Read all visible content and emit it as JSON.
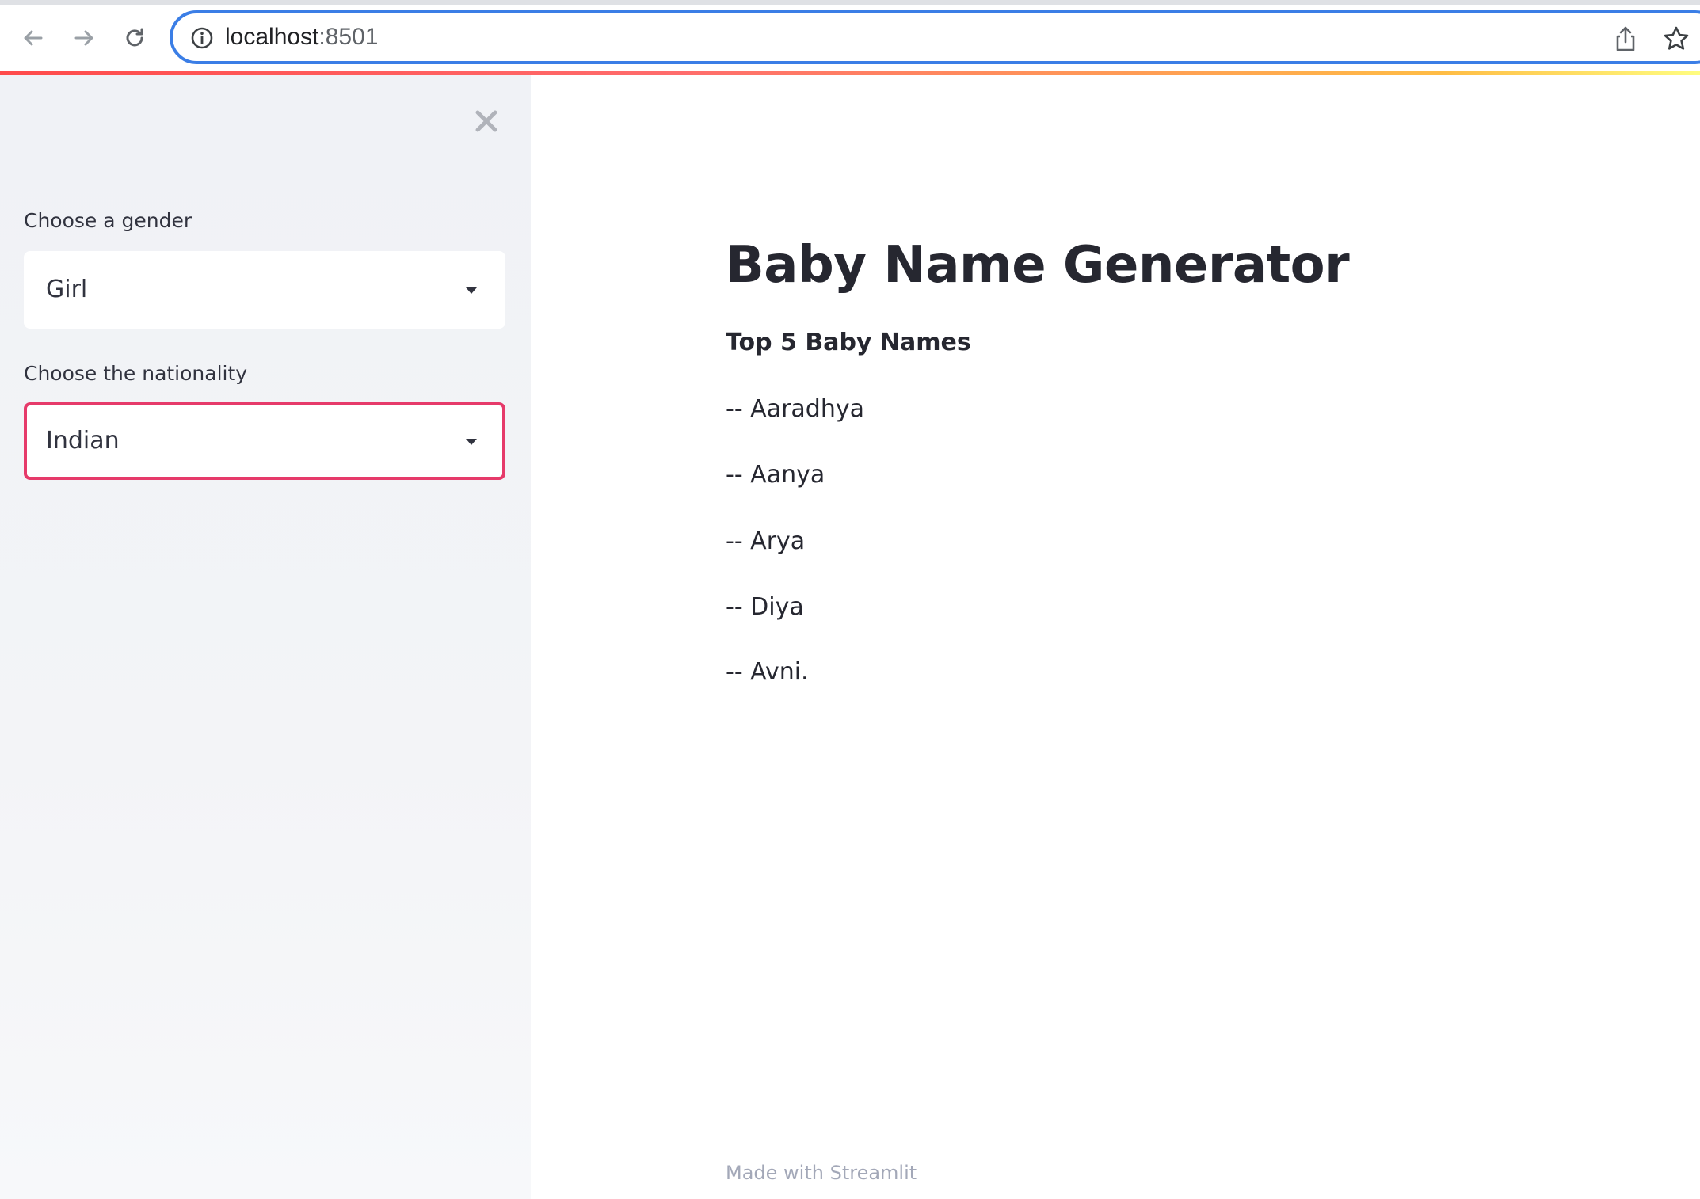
{
  "browser": {
    "url_host": "localhost",
    "url_port": ":8501"
  },
  "sidebar": {
    "gender_label": "Choose a gender",
    "gender_value": "Girl",
    "nationality_label": "Choose the nationality",
    "nationality_value": "Indian"
  },
  "main": {
    "title": "Baby Name Generator",
    "subheading": "Top 5 Baby Names",
    "names": [
      "-- Aaradhya",
      "-- Aanya",
      "-- Arya",
      "-- Diya",
      "-- Avni."
    ]
  },
  "footer": {
    "text": "Made with Streamlit"
  },
  "icons": {
    "back": "arrow-left-icon",
    "forward": "arrow-right-icon",
    "reload": "reload-icon",
    "info": "info-icon",
    "share": "share-icon",
    "bookmark": "star-icon",
    "close": "close-icon",
    "caret": "caret-down-icon"
  },
  "colors": {
    "accent": "#e63a6a",
    "address_focus": "#3b7ee6",
    "sidebar_bg": "#f0f2f6",
    "text": "#262730",
    "footer": "#a3a8b8"
  }
}
